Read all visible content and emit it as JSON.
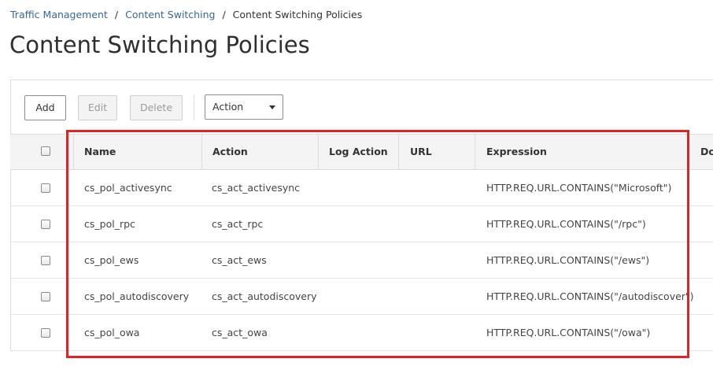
{
  "breadcrumb": {
    "items": [
      "Traffic Management",
      "Content Switching"
    ],
    "separator": "/",
    "current": "Content Switching Policies"
  },
  "page": {
    "title": "Content Switching Policies"
  },
  "toolbar": {
    "add_label": "Add",
    "edit_label": "Edit",
    "delete_label": "Delete",
    "action_select": "Action"
  },
  "table": {
    "columns": [
      "Name",
      "Action",
      "Log Action",
      "URL",
      "Expression",
      "Do"
    ],
    "rows": [
      {
        "name": "cs_pol_activesync",
        "action": "cs_act_activesync",
        "log_action": "",
        "url": "",
        "expression": "HTTP.REQ.URL.CONTAINS(\"Microsoft\")"
      },
      {
        "name": "cs_pol_rpc",
        "action": "cs_act_rpc",
        "log_action": "",
        "url": "",
        "expression": "HTTP.REQ.URL.CONTAINS(\"/rpc\")"
      },
      {
        "name": "cs_pol_ews",
        "action": "cs_act_ews",
        "log_action": "",
        "url": "",
        "expression": "HTTP.REQ.URL.CONTAINS(\"/ews\")"
      },
      {
        "name": "cs_pol_autodiscovery",
        "action": "cs_act_autodiscovery",
        "log_action": "",
        "url": "",
        "expression": "HTTP.REQ.URL.CONTAINS(\"/autodiscover\")"
      },
      {
        "name": "cs_pol_owa",
        "action": "cs_act_owa",
        "log_action": "",
        "url": "",
        "expression": "HTTP.REQ.URL.CONTAINS(\"/owa\")"
      }
    ]
  },
  "colors": {
    "link": "#35689e",
    "highlight_border": "#e02424",
    "header_bg": "#f4f4f4"
  }
}
